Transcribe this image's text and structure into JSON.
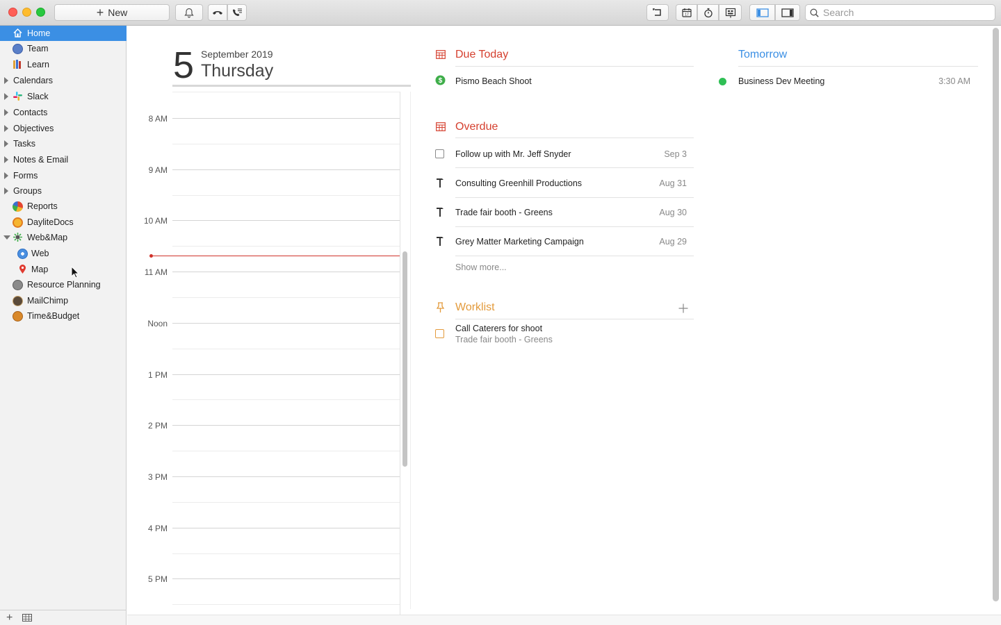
{
  "toolbar": {
    "new_label": "New",
    "search_placeholder": "Search",
    "icons": [
      "bell-icon",
      "phone-hangup-icon",
      "phone-call-icon",
      "undo-icon",
      "calendar-icon",
      "timer-icon",
      "presentation-icon",
      "left-panel-icon",
      "right-panel-icon",
      "search-icon"
    ]
  },
  "sidebar": {
    "items": [
      {
        "label": "Home",
        "selected": true,
        "icon": "home-icon"
      },
      {
        "label": "Team",
        "icon": "team-icon"
      },
      {
        "label": "Learn",
        "icon": "books-icon"
      },
      {
        "label": "Calendars",
        "expandable": true
      },
      {
        "label": "Slack",
        "expandable": true,
        "icon": "slack-icon"
      },
      {
        "label": "Contacts",
        "expandable": true
      },
      {
        "label": "Objectives",
        "expandable": true
      },
      {
        "label": "Tasks",
        "expandable": true
      },
      {
        "label": "Notes & Email",
        "expandable": true
      },
      {
        "label": "Forms",
        "expandable": true
      },
      {
        "label": "Groups",
        "expandable": true
      },
      {
        "label": "Reports",
        "icon": "reports-icon"
      },
      {
        "label": "DayliteDocs",
        "icon": "daylitedocs-icon"
      },
      {
        "label": "Web&Map",
        "expanded": true,
        "icon": "webmap-icon"
      },
      {
        "label": "Web",
        "child": true,
        "icon": "web-icon"
      },
      {
        "label": "Map",
        "child": true,
        "icon": "map-pin-icon"
      },
      {
        "label": "Resource Planning",
        "icon": "resource-planning-icon"
      },
      {
        "label": "MailChimp",
        "icon": "mailchimp-icon"
      },
      {
        "label": "Time&Budget",
        "icon": "time-budget-icon"
      }
    ]
  },
  "day": {
    "number": "5",
    "month_year": "September 2019",
    "weekday": "Thursday",
    "hours": [
      "8 AM",
      "9 AM",
      "10 AM",
      "11 AM",
      "Noon",
      "1 PM",
      "2 PM",
      "3 PM",
      "4 PM",
      "5 PM"
    ]
  },
  "due_today": {
    "title": "Due Today",
    "items": [
      {
        "title": "Pismo Beach Shoot"
      }
    ]
  },
  "overdue": {
    "title": "Overdue",
    "items": [
      {
        "title": "Follow up with Mr. Jeff Snyder",
        "date": "Sep 3",
        "kind": "task"
      },
      {
        "title": "Consulting Greenhill Productions",
        "date": "Aug 31",
        "kind": "project"
      },
      {
        "title": "Trade fair booth - Greens",
        "date": "Aug 30",
        "kind": "project"
      },
      {
        "title": "Grey Matter Marketing Campaign",
        "date": "Aug 29",
        "kind": "project"
      }
    ],
    "show_more": "Show more..."
  },
  "worklist": {
    "title": "Worklist",
    "items": [
      {
        "title": "Call Caterers for shoot",
        "subtitle": "Trade fair booth - Greens"
      }
    ]
  },
  "tomorrow": {
    "title": "Tomorrow",
    "items": [
      {
        "title": "Business Dev Meeting",
        "time": "3:30 AM"
      }
    ]
  },
  "colors": {
    "accent": "#3b8fe4",
    "overdue_red": "#d5402f",
    "worklist_orange": "#e39a3b",
    "event_green": "#2fbf55"
  }
}
